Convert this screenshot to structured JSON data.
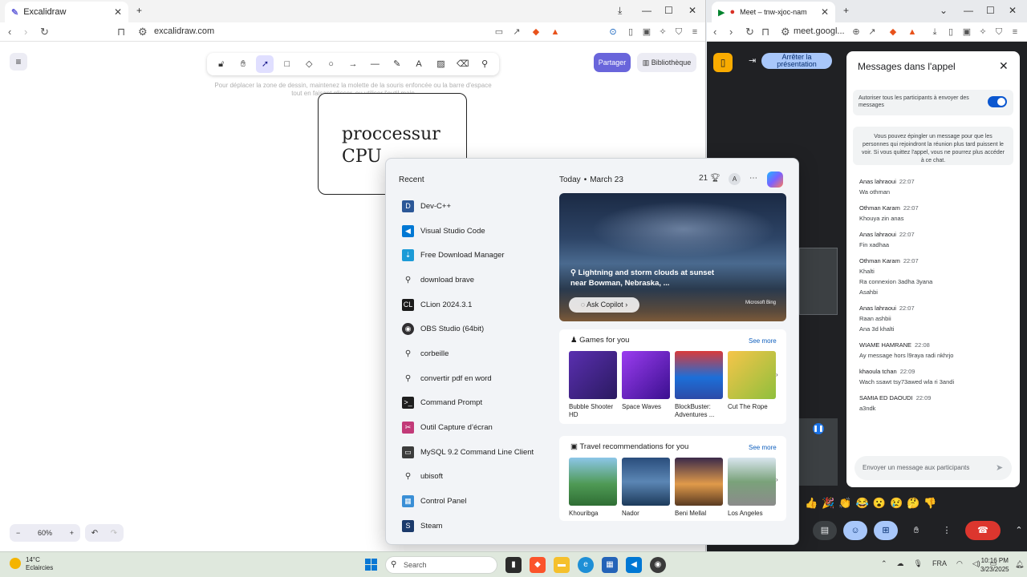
{
  "left_browser": {
    "tab_title": "Excalidraw",
    "url": "excalidraw.com",
    "excalidraw": {
      "share_label": "Partager",
      "library_label": "Bibliothèque",
      "hint": "Pour déplacer la zone de dessin, maintenez la molette de la souris enfoncée ou la barre d'espace tout en faisant glisser, ou utiliser l'outil main",
      "canvas_text": "proccessur\nCPU",
      "zoom": "60%",
      "tools": [
        "lock-icon",
        "hand-icon",
        "selection-icon",
        "rectangle-icon",
        "diamond-icon",
        "ellipse-icon",
        "arrow-icon",
        "line-icon",
        "pencil-icon",
        "text-icon",
        "image-icon",
        "eraser-icon",
        "extra-tools-icon"
      ]
    }
  },
  "right_browser": {
    "tab_title": "Meet – tnw-xjoc-nam",
    "url": "meet.googl...",
    "present_label": "Arrêter la présentation",
    "chat": {
      "title": "Messages dans l'appel",
      "toggle_label": "Autoriser tous les participants à envoyer des messages",
      "info": "Vous pouvez épingler un message pour que les personnes qui rejoindront la réunion plus tard puissent le voir. Si vous quittez l'appel, vous ne pourrez plus accéder à ce chat.",
      "input_placeholder": "Envoyer un message aux participants",
      "messages": [
        {
          "author": "Anas lahraoui",
          "time": "22:07",
          "lines": [
            "Wa othman"
          ]
        },
        {
          "author": "Othman Karam",
          "time": "22:07",
          "lines": [
            "Khouya zin anas"
          ]
        },
        {
          "author": "Anas lahraoui",
          "time": "22:07",
          "lines": [
            "Fin xadhaa"
          ]
        },
        {
          "author": "Othman Karam",
          "time": "22:07",
          "lines": [
            "Khalti",
            "Ra connexion 3adha 3yana",
            "Asahbi"
          ]
        },
        {
          "author": "Anas lahraoui",
          "time": "22:07",
          "lines": [
            "Raan ashbii",
            "Ana 3d khalti"
          ]
        },
        {
          "author": "WIAME HAMRANE",
          "time": "22:08",
          "lines": [
            "Ay message hors l9raya radi nkhrjo"
          ]
        },
        {
          "author": "khaoula tchan",
          "time": "22:09",
          "lines": [
            "Wach ssawt tsy73awed wla ri 3andi"
          ]
        },
        {
          "author": "SAMIA ED DAOUDI",
          "time": "22:09",
          "lines": [
            "a3ndk"
          ]
        }
      ]
    },
    "emojis": [
      "👍",
      "🎉",
      "👏",
      "😂",
      "😮",
      "😢",
      "🤔",
      "👎"
    ]
  },
  "start_menu": {
    "recent_title": "Recent",
    "recent": [
      {
        "label": "Dev-C++",
        "icon": "devcpp-icon",
        "color": "#2b5797"
      },
      {
        "label": "Visual Studio Code",
        "icon": "vscode-icon",
        "color": "#0078d4"
      },
      {
        "label": "Free Download Manager",
        "icon": "fdm-icon",
        "color": "#1c9bd7"
      },
      {
        "label": "download brave",
        "icon": "search-icon",
        "color": ""
      },
      {
        "label": "CLion 2024.3.1",
        "icon": "clion-icon",
        "color": "#1b1b1b"
      },
      {
        "label": "OBS Studio (64bit)",
        "icon": "obs-icon",
        "color": "#302e31"
      },
      {
        "label": "corbeille",
        "icon": "search-icon",
        "color": ""
      },
      {
        "label": "convertir pdf en word",
        "icon": "search-icon",
        "color": ""
      },
      {
        "label": "Command Prompt",
        "icon": "cmd-icon",
        "color": "#1e1e1e"
      },
      {
        "label": "Outil Capture d’écran",
        "icon": "snipping-icon",
        "color": "#c23a78"
      },
      {
        "label": "MySQL 9.2 Command Line Client",
        "icon": "mysql-icon",
        "color": "#3c3c3c"
      },
      {
        "label": "ubisoft",
        "icon": "search-icon",
        "color": ""
      },
      {
        "label": "Control Panel",
        "icon": "control-panel-icon",
        "color": "#3a8fd6"
      },
      {
        "label": "Steam",
        "icon": "steam-icon",
        "color": "#1b3a6b"
      }
    ],
    "today": "Today",
    "date": "March 23",
    "weather_num": "21",
    "avatar_letter": "A",
    "hero": {
      "caption": "Lightning and storm clouds at sunset near Bowman, Nebraska, ...",
      "ask_label": "Ask Copilot",
      "bing": "Microsoft Bing"
    },
    "games": {
      "title": "Games for you",
      "more": "See more",
      "items": [
        {
          "label": "Bubble Shooter HD",
          "color": "#3b2a7a"
        },
        {
          "label": "Space Waves",
          "color": "#7a2bd6"
        },
        {
          "label": "BlockBuster: Adventures ...",
          "color": "#1c6fd8"
        },
        {
          "label": "Cut The Rope",
          "color": "#f0b23a"
        }
      ]
    },
    "travel": {
      "title": "Travel recommendations for you",
      "more": "See more",
      "items": [
        {
          "label": "Khouribga",
          "color": "#3f8a4a"
        },
        {
          "label": "Nador",
          "color": "#2b4f78"
        },
        {
          "label": "Beni Mellal",
          "color": "#a0623a"
        },
        {
          "label": "Los Angeles",
          "color": "#6c8f62"
        }
      ]
    }
  },
  "taskbar": {
    "temp": "14°C",
    "condition": "Eclaircies",
    "search_placeholder": "Search",
    "lang": "FRA",
    "time": "10:16 PM",
    "date": "3/23/2025"
  }
}
